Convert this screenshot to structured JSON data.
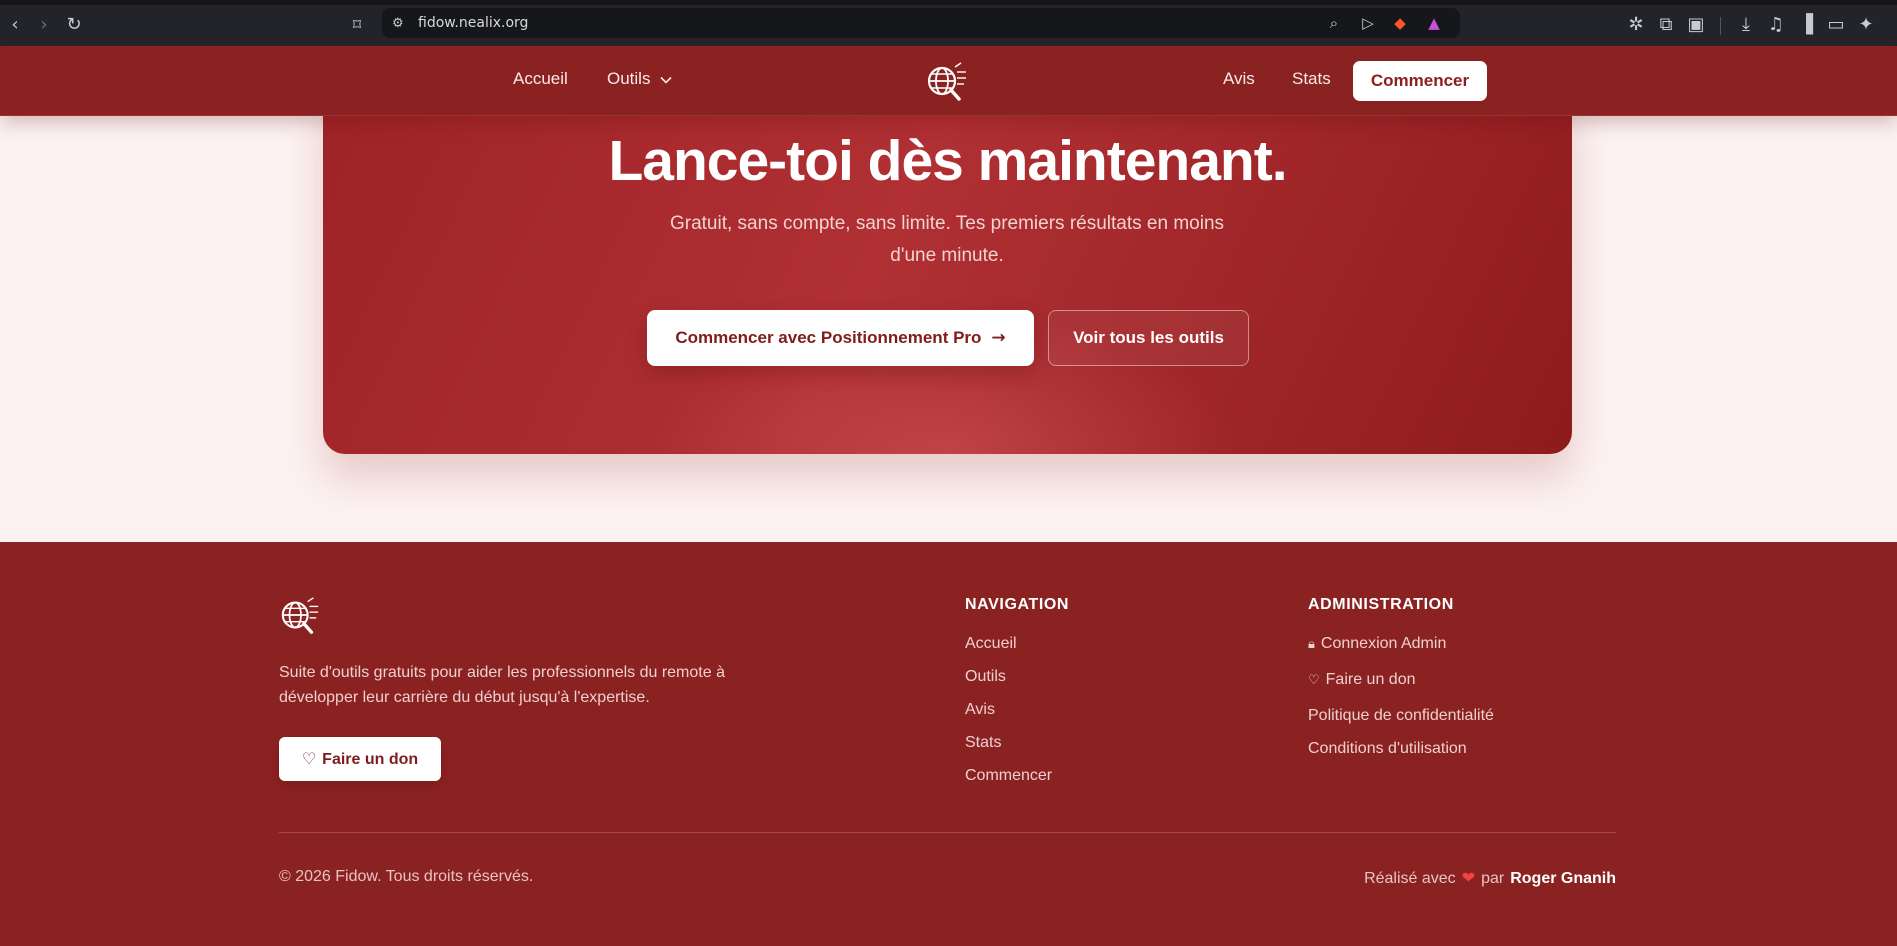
{
  "browser": {
    "url": "fidow.nealix.org"
  },
  "header": {
    "nav_home": "Accueil",
    "nav_tools": "Outils",
    "nav_reviews": "Avis",
    "nav_stats": "Stats",
    "cta_label": "Commencer"
  },
  "cta": {
    "title": "Lance-toi dès maintenant.",
    "subtitle": "Gratuit, sans compte, sans limite. Tes premiers résultats en moins d'une minute.",
    "primary_label": "Commencer avec Positionnement Pro",
    "secondary_label": "Voir tous les outils"
  },
  "footer": {
    "description": "Suite d'outils gratuits pour aider les professionnels du remote à développer leur carrière du début jusqu'à l'expertise.",
    "donate_label": "Faire un don",
    "navigation": {
      "title": "NAVIGATION",
      "items": [
        "Accueil",
        "Outils",
        "Avis",
        "Stats",
        "Commencer"
      ]
    },
    "administration": {
      "title": "ADMINISTRATION",
      "admin_login": "Connexion Admin",
      "donate": "Faire un don",
      "privacy": "Politique de confidentialité",
      "terms": "Conditions d'utilisation"
    },
    "copyright": "© 2026 Fidow. Tous droits réservés.",
    "credit_prefix": "Réalisé avec",
    "credit_by": "par",
    "credit_author": "Roger Gnanih"
  },
  "colors": {
    "brand": "#8b2222",
    "accent_white": "#ffffff"
  }
}
